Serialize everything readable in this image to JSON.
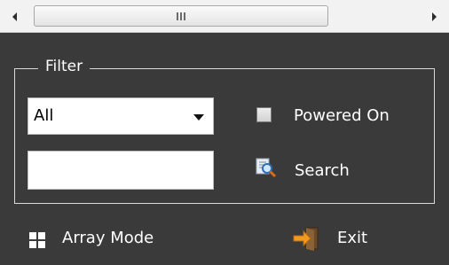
{
  "scrollbar": {
    "left_icon": "arrow-left-icon",
    "right_icon": "arrow-right-icon",
    "thumb_grip_icon": "grip-icon"
  },
  "filter": {
    "legend": "Filter",
    "select": {
      "value": "All"
    },
    "checkbox": {
      "label": "Powered On",
      "checked": false
    },
    "search_input": {
      "value": ""
    },
    "search": {
      "label": "Search",
      "icon": "search-icon"
    }
  },
  "footer": {
    "array_mode": {
      "label": "Array Mode",
      "icon": "grid-icon"
    },
    "exit": {
      "label": "Exit",
      "icon": "exit-door-icon"
    }
  },
  "colors": {
    "background": "#3a3a3a",
    "text": "#ffffff",
    "exit_arrow": "#f29a1f"
  }
}
